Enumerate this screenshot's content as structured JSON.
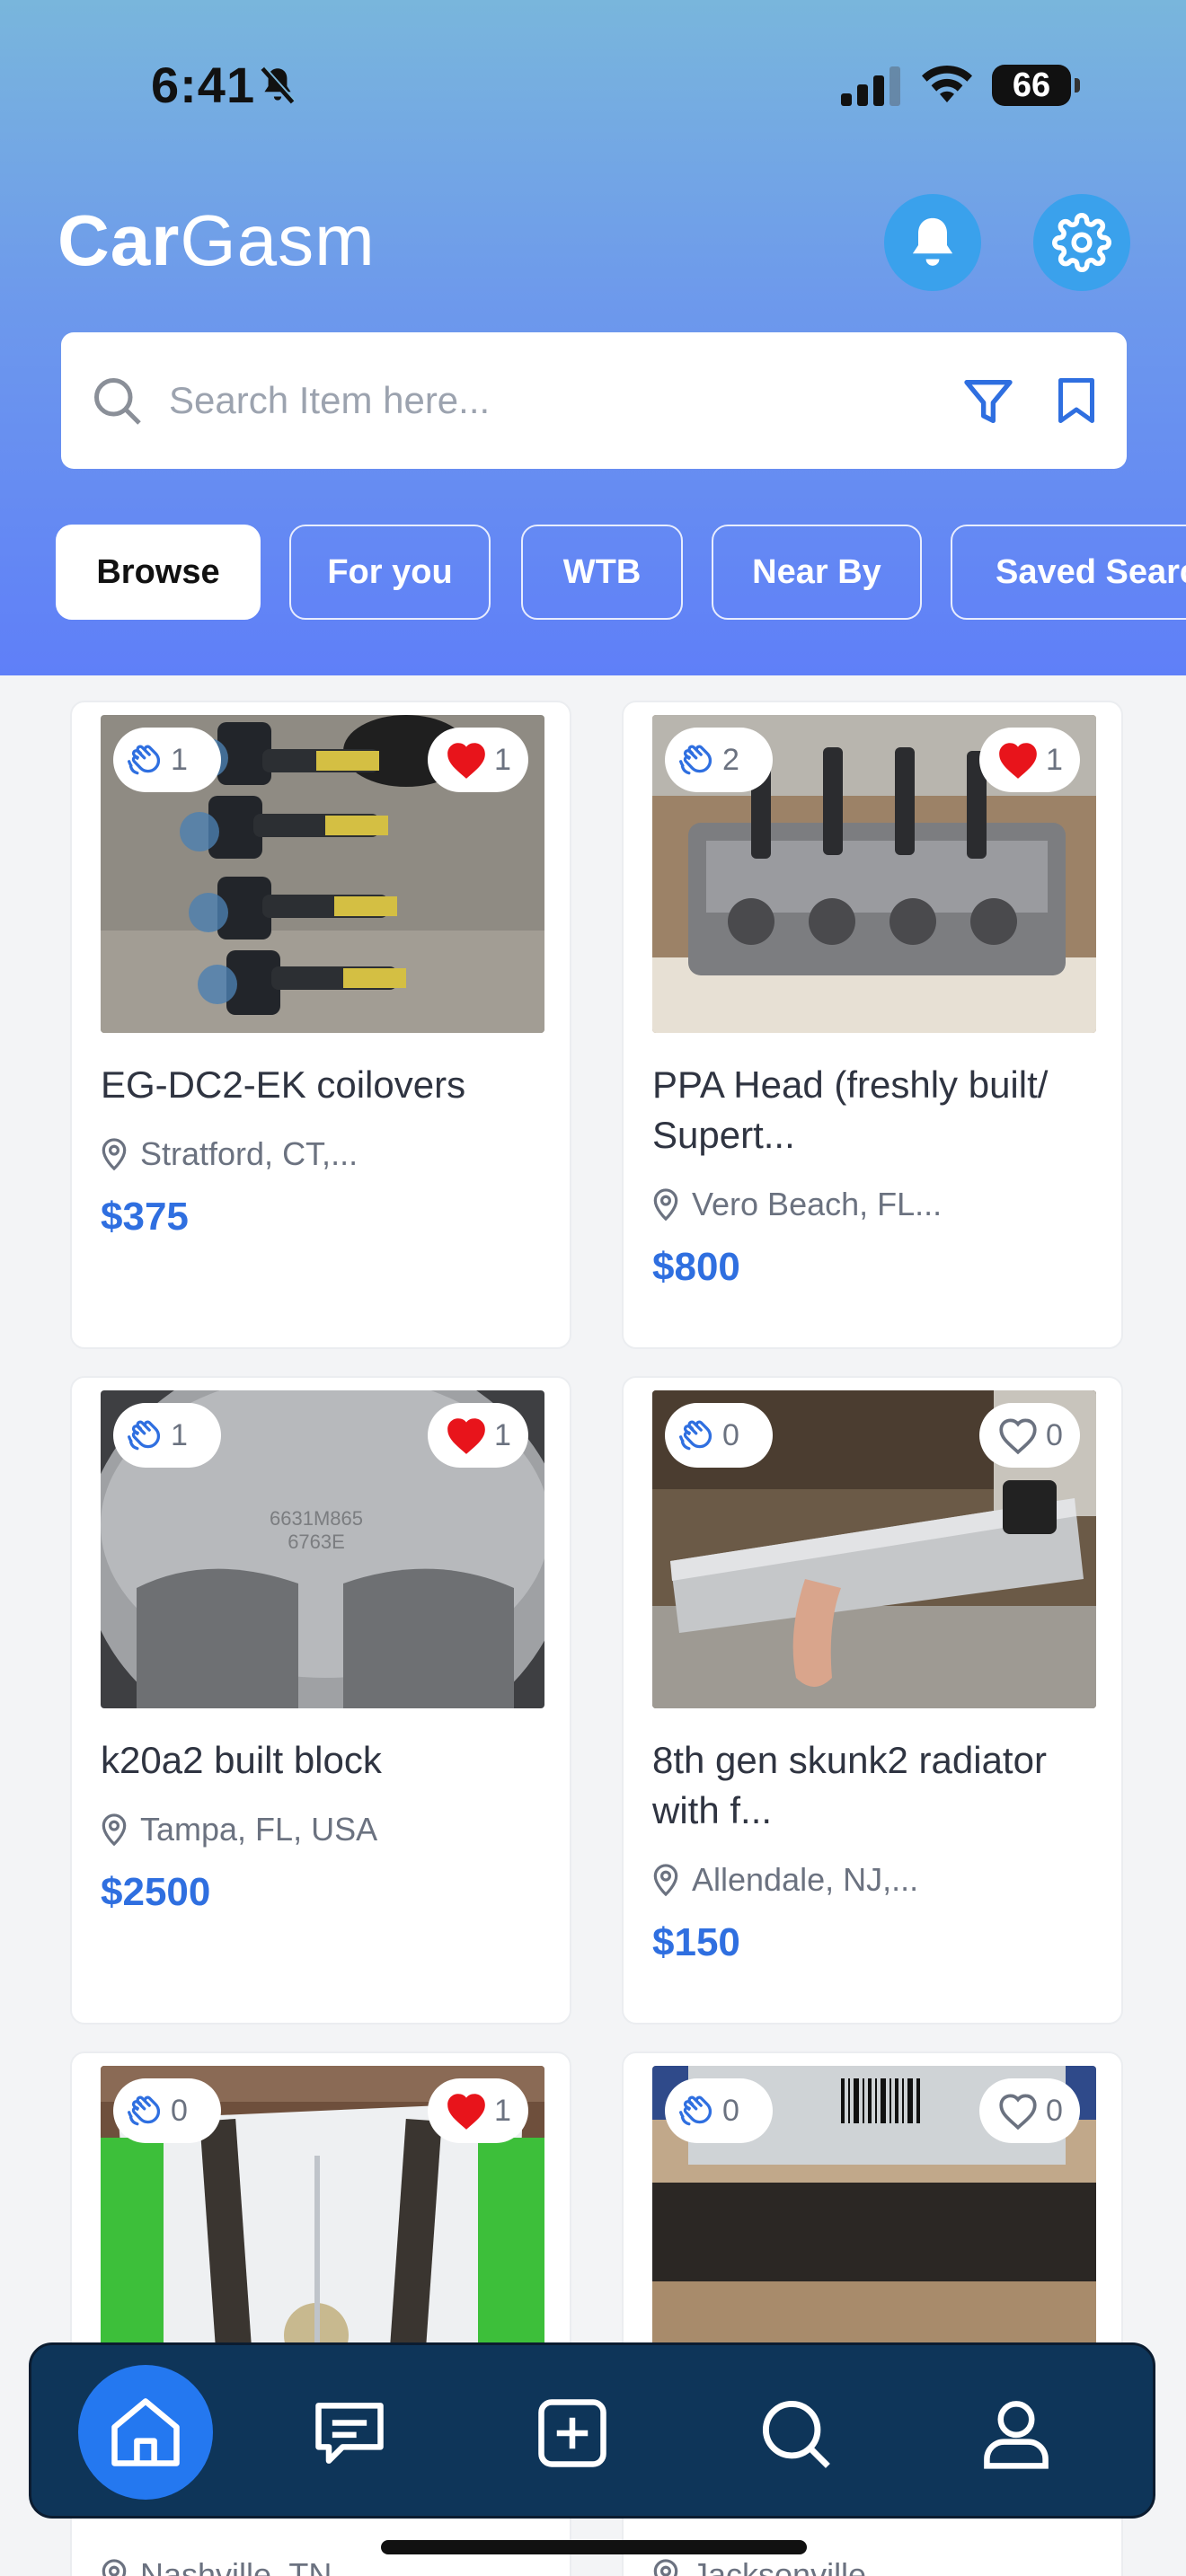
{
  "status_bar": {
    "time": "6:41",
    "battery": "66"
  },
  "header": {
    "app_title_bold": "Car",
    "app_title_rest": "Gasm"
  },
  "search": {
    "placeholder": "Search Item here..."
  },
  "tabs": [
    {
      "label": "Browse",
      "active": true
    },
    {
      "label": "For you",
      "active": false
    },
    {
      "label": "WTB",
      "active": false
    },
    {
      "label": "Near By",
      "active": false
    },
    {
      "label": "Saved Searc",
      "active": false
    }
  ],
  "listings": [
    {
      "title": "EG-DC2-EK coilovers",
      "location": "Stratford, CT,...",
      "price": "$375",
      "offers": "1",
      "likes": "1",
      "liked": true
    },
    {
      "title": "PPA Head (freshly built/ Supert...",
      "location": "Vero Beach, FL...",
      "price": "$800",
      "offers": "2",
      "likes": "1",
      "liked": true
    },
    {
      "title": "k20a2 built block",
      "location": "Tampa, FL, USA",
      "price": "$2500",
      "offers": "1",
      "likes": "1",
      "liked": true
    },
    {
      "title": "8th gen skunk2 radiator with f...",
      "location": "Allendale, NJ,...",
      "price": "$150",
      "offers": "0",
      "likes": "0",
      "liked": false
    },
    {
      "title": "",
      "location": "Nashville, TN,...",
      "price": "",
      "offers": "0",
      "likes": "1",
      "liked": true
    },
    {
      "title": "",
      "location": "Jacksonville, ...",
      "price": "",
      "offers": "0",
      "likes": "0",
      "liked": false
    }
  ],
  "photo_text": {
    "piston_stamp_1": "6631M865",
    "piston_stamp_2": "6763E"
  },
  "bottom_nav": [
    "home-icon",
    "messages-icon",
    "add-listing-icon",
    "search-icon",
    "profile-icon"
  ],
  "colors": {
    "accent": "#2f6fe0",
    "nav_bg": "#0e3559",
    "nav_active": "#2478f0",
    "like_red": "#e8141b"
  }
}
